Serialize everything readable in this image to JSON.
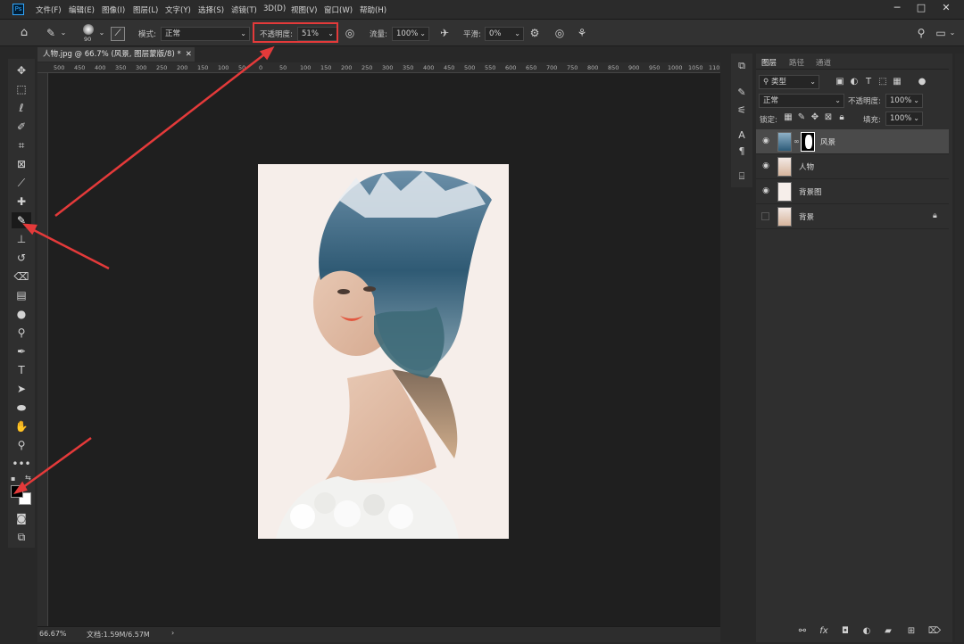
{
  "app": {
    "logo_text": "Ps"
  },
  "menu": [
    "文件(F)",
    "编辑(E)",
    "图像(I)",
    "图层(L)",
    "文字(Y)",
    "选择(S)",
    "滤镜(T)",
    "3D(D)",
    "视图(V)",
    "窗口(W)",
    "帮助(H)"
  ],
  "window_controls": {
    "minimize": "─",
    "maximize": "□",
    "close": "✕"
  },
  "options": {
    "brush_size": "90",
    "mode_label": "模式:",
    "mode_value": "正常",
    "opacity_label": "不透明度:",
    "opacity_value": "51%",
    "flow_label": "流量:",
    "flow_value": "100%",
    "smoothing_label": "平滑:",
    "smoothing_value": "0%"
  },
  "document": {
    "tab_title": "人物.jpg @ 66.7% (风景, 图层蒙版/8) *",
    "ruler_ticks": [
      "500",
      "450",
      "400",
      "350",
      "300",
      "250",
      "200",
      "150",
      "100",
      "50",
      "0",
      "50",
      "100",
      "150",
      "200",
      "250",
      "300",
      "350",
      "400",
      "450",
      "500",
      "550",
      "600",
      "650",
      "700",
      "750",
      "800",
      "850",
      "900",
      "950",
      "1000",
      "1050",
      "110"
    ],
    "zoom": "66.67%",
    "doc_info": "文档:1.59M/6.57M"
  },
  "layers_panel": {
    "tabs": [
      "图层",
      "路径",
      "通道"
    ],
    "filter_kind": "类型",
    "blend_mode": "正常",
    "opacity_label": "不透明度:",
    "opacity_value": "100%",
    "lock_label": "锁定:",
    "fill_label": "填充:",
    "fill_value": "100%",
    "layers": [
      {
        "name": "风景",
        "visible": true,
        "selected": true,
        "has_mask": true
      },
      {
        "name": "人物",
        "visible": true,
        "selected": false,
        "has_mask": false
      },
      {
        "name": "背景图",
        "visible": true,
        "selected": false,
        "has_mask": false
      },
      {
        "name": "背景",
        "visible": false,
        "selected": false,
        "has_mask": false,
        "locked": true
      }
    ],
    "footer_icons": [
      "link-icon",
      "fx-icon",
      "mask-icon",
      "adjustment-icon",
      "folder-icon",
      "new-layer-icon",
      "trash-icon"
    ]
  },
  "colors": {
    "accent": "#31a8ff",
    "annotation": "#e43a3a",
    "canvas_bg": "#1f1f1f",
    "panel_bg": "#2f2f2f"
  }
}
